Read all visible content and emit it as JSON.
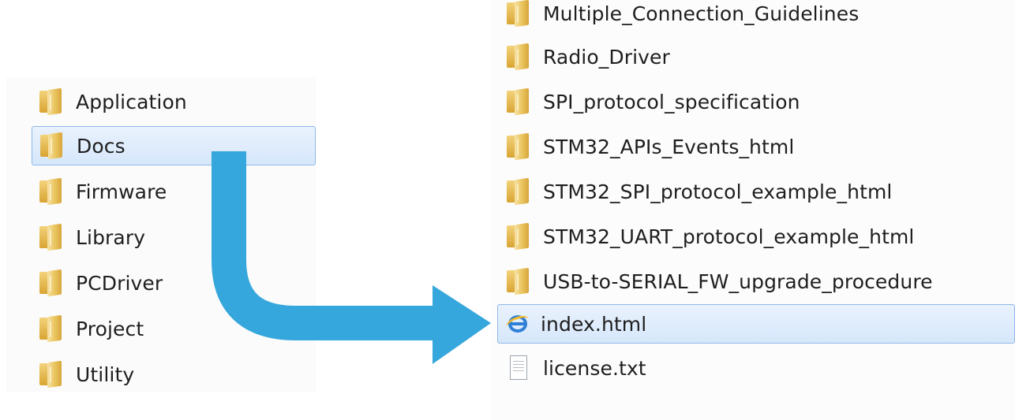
{
  "left_panel": {
    "items": [
      {
        "label": "Application",
        "icon": "folder-icon",
        "selected": false
      },
      {
        "label": "Docs",
        "icon": "folder-icon",
        "selected": true
      },
      {
        "label": "Firmware",
        "icon": "folder-icon",
        "selected": false
      },
      {
        "label": "Library",
        "icon": "folder-icon",
        "selected": false
      },
      {
        "label": "PCDriver",
        "icon": "folder-icon",
        "selected": false
      },
      {
        "label": "Project",
        "icon": "folder-icon",
        "selected": false
      },
      {
        "label": "Utility",
        "icon": "folder-icon",
        "selected": false
      }
    ]
  },
  "right_panel": {
    "items": [
      {
        "label": "Multiple_Connection_Guidelines",
        "icon": "folder-icon",
        "selected": false
      },
      {
        "label": "Radio_Driver",
        "icon": "folder-icon",
        "selected": false
      },
      {
        "label": "SPI_protocol_specification",
        "icon": "folder-icon",
        "selected": false
      },
      {
        "label": "STM32_APIs_Events_html",
        "icon": "folder-icon",
        "selected": false
      },
      {
        "label": "STM32_SPI_protocol_example_html",
        "icon": "folder-icon",
        "selected": false
      },
      {
        "label": "STM32_UART_protocol_example_html",
        "icon": "folder-icon",
        "selected": false
      },
      {
        "label": "USB-to-SERIAL_FW_upgrade_procedure",
        "icon": "folder-icon",
        "selected": false
      },
      {
        "label": "index.html",
        "icon": "internet-explorer-icon",
        "selected": true
      },
      {
        "label": "license.txt",
        "icon": "text-file-icon",
        "selected": false
      }
    ]
  },
  "colors": {
    "arrow": "#36a7dc",
    "selection_fill": "#dbe9fb",
    "selection_border": "#8fb8e8"
  }
}
